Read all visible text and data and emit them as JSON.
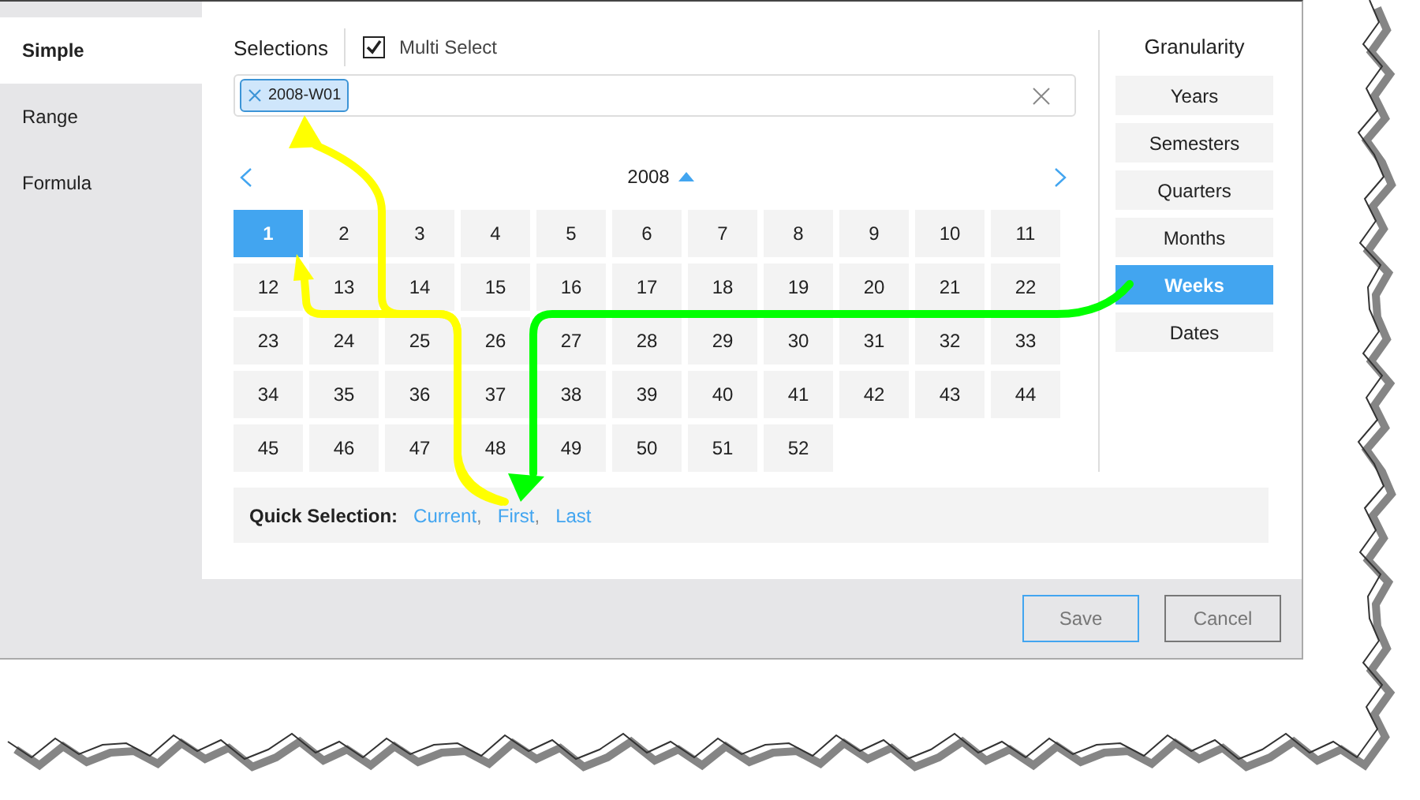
{
  "sidebar": {
    "items": [
      {
        "label": "Simple",
        "selected": true
      },
      {
        "label": "Range",
        "selected": false
      },
      {
        "label": "Formula",
        "selected": false
      }
    ]
  },
  "selections": {
    "title": "Selections",
    "multi_select": {
      "label": "Multi Select",
      "checked": true
    },
    "tags": [
      {
        "label": "2008-W01"
      }
    ]
  },
  "calendar": {
    "year": "2008",
    "weeks": [
      {
        "label": "1",
        "selected": true
      },
      {
        "label": "2",
        "selected": false
      },
      {
        "label": "3",
        "selected": false
      },
      {
        "label": "4",
        "selected": false
      },
      {
        "label": "5",
        "selected": false
      },
      {
        "label": "6",
        "selected": false
      },
      {
        "label": "7",
        "selected": false
      },
      {
        "label": "8",
        "selected": false
      },
      {
        "label": "9",
        "selected": false
      },
      {
        "label": "10",
        "selected": false
      },
      {
        "label": "11",
        "selected": false
      },
      {
        "label": "12",
        "selected": false
      },
      {
        "label": "13",
        "selected": false
      },
      {
        "label": "14",
        "selected": false
      },
      {
        "label": "15",
        "selected": false
      },
      {
        "label": "16",
        "selected": false
      },
      {
        "label": "17",
        "selected": false
      },
      {
        "label": "18",
        "selected": false
      },
      {
        "label": "19",
        "selected": false
      },
      {
        "label": "20",
        "selected": false
      },
      {
        "label": "21",
        "selected": false
      },
      {
        "label": "22",
        "selected": false
      },
      {
        "label": "23",
        "selected": false
      },
      {
        "label": "24",
        "selected": false
      },
      {
        "label": "25",
        "selected": false
      },
      {
        "label": "26",
        "selected": false
      },
      {
        "label": "27",
        "selected": false
      },
      {
        "label": "28",
        "selected": false
      },
      {
        "label": "29",
        "selected": false
      },
      {
        "label": "30",
        "selected": false
      },
      {
        "label": "31",
        "selected": false
      },
      {
        "label": "32",
        "selected": false
      },
      {
        "label": "33",
        "selected": false
      },
      {
        "label": "34",
        "selected": false
      },
      {
        "label": "35",
        "selected": false
      },
      {
        "label": "36",
        "selected": false
      },
      {
        "label": "37",
        "selected": false
      },
      {
        "label": "38",
        "selected": false
      },
      {
        "label": "39",
        "selected": false
      },
      {
        "label": "40",
        "selected": false
      },
      {
        "label": "41",
        "selected": false
      },
      {
        "label": "42",
        "selected": false
      },
      {
        "label": "43",
        "selected": false
      },
      {
        "label": "44",
        "selected": false
      },
      {
        "label": "45",
        "selected": false
      },
      {
        "label": "46",
        "selected": false
      },
      {
        "label": "47",
        "selected": false
      },
      {
        "label": "48",
        "selected": false
      },
      {
        "label": "49",
        "selected": false
      },
      {
        "label": "50",
        "selected": false
      },
      {
        "label": "51",
        "selected": false
      },
      {
        "label": "52",
        "selected": false
      }
    ]
  },
  "granularity": {
    "title": "Granularity",
    "options": [
      {
        "label": "Years",
        "selected": false
      },
      {
        "label": "Semesters",
        "selected": false
      },
      {
        "label": "Quarters",
        "selected": false
      },
      {
        "label": "Months",
        "selected": false
      },
      {
        "label": "Weeks",
        "selected": true
      },
      {
        "label": "Dates",
        "selected": false
      }
    ]
  },
  "quick_selection": {
    "label": "Quick Selection:",
    "links": [
      {
        "label": "Current",
        "separator": ","
      },
      {
        "label": "First",
        "separator": ","
      },
      {
        "label": "Last"
      }
    ]
  },
  "buttons": [
    {
      "label": "Save",
      "default": true
    },
    {
      "label": "Cancel",
      "default": false
    }
  ],
  "annotation_arrows": [
    {
      "color": "#ffff00"
    },
    {
      "color": "#ffff00"
    },
    {
      "color": "#00ff00"
    }
  ]
}
